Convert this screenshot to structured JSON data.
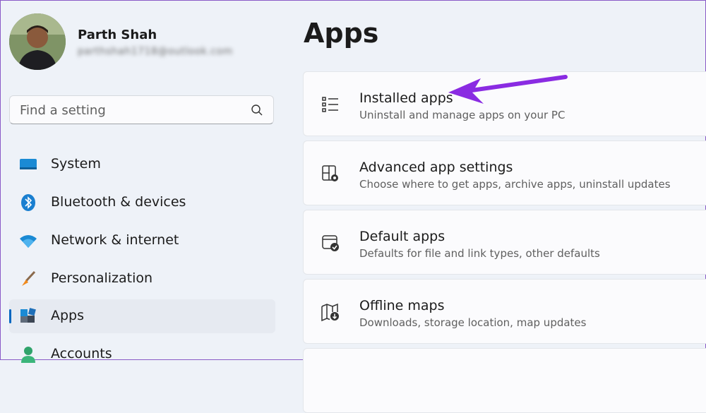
{
  "profile": {
    "name": "Parth Shah",
    "email": "parthshah1718@outlook.com"
  },
  "search": {
    "placeholder": "Find a setting"
  },
  "nav": {
    "items": [
      {
        "label": "System",
        "icon": "monitor-icon"
      },
      {
        "label": "Bluetooth & devices",
        "icon": "bluetooth-icon"
      },
      {
        "label": "Network & internet",
        "icon": "wifi-icon"
      },
      {
        "label": "Personalization",
        "icon": "brush-icon"
      },
      {
        "label": "Apps",
        "icon": "apps-icon",
        "selected": true
      },
      {
        "label": "Accounts",
        "icon": "account-icon"
      }
    ]
  },
  "main": {
    "title": "Apps",
    "cards": [
      {
        "title": "Installed apps",
        "subtitle": "Uninstall and manage apps on your PC",
        "icon": "list-icon"
      },
      {
        "title": "Advanced app settings",
        "subtitle": "Choose where to get apps, archive apps, uninstall updates",
        "icon": "app-settings-icon"
      },
      {
        "title": "Default apps",
        "subtitle": "Defaults for file and link types, other defaults",
        "icon": "default-apps-icon"
      },
      {
        "title": "Offline maps",
        "subtitle": "Downloads, storage location, map updates",
        "icon": "map-icon"
      }
    ]
  },
  "colors": {
    "accent": "#0067c0",
    "annotation_arrow": "#8a2be2"
  }
}
